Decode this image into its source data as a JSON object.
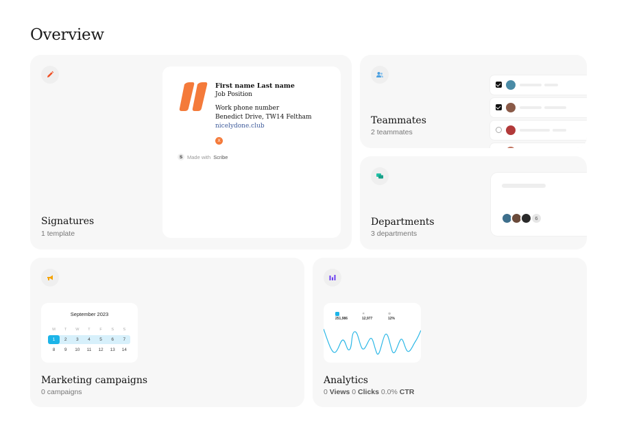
{
  "page": {
    "title": "Overview"
  },
  "signatures": {
    "title": "Signatures",
    "subtitle": "1 template",
    "preview": {
      "name": "First name Last name",
      "position": "Job Position",
      "phone": "Work phone number",
      "address": "Benedict Drive, TW14 Feltham",
      "website": "nicelydone.club",
      "social_badge": "X",
      "made_with_prefix": "Made with",
      "made_with_brand": "Scribe",
      "brand_badge": "S"
    },
    "logo_color": "#f47a3a"
  },
  "teammates": {
    "title": "Teammates",
    "subtitle": "2 teammates",
    "rows": [
      {
        "checked": true,
        "avatar_color": "#4a8ba6"
      },
      {
        "checked": true,
        "avatar_color": "#8a5a48"
      },
      {
        "checked": false,
        "avatar_color": "#b23a3a"
      }
    ]
  },
  "departments": {
    "title": "Departments",
    "subtitle": "3 departments",
    "extra_count": "6",
    "avatar_colors": [
      "#3e6f8c",
      "#6a4a3a",
      "#2a2a2a"
    ]
  },
  "marketing": {
    "title": "Marketing campaigns",
    "subtitle": "0 campaigns",
    "calendar": {
      "month": "September 2023",
      "weekdays": [
        "M",
        "T",
        "W",
        "T",
        "F",
        "S",
        "S"
      ],
      "week1": [
        "1",
        "2",
        "3",
        "4",
        "5",
        "6",
        "7"
      ],
      "week2": [
        "8",
        "9",
        "10",
        "11",
        "12",
        "13",
        "14"
      ],
      "selected": "1"
    }
  },
  "analytics": {
    "title": "Analytics",
    "views_value": "0",
    "views_label": "Views",
    "clicks_value": "0",
    "clicks_label": "Clicks",
    "ctr_value": "0.0%",
    "ctr_label": "CTR",
    "mini_stats": [
      {
        "value": "251,986"
      },
      {
        "value": "12,977"
      },
      {
        "value": "12%"
      }
    ],
    "line_color": "#2bb7e6"
  },
  "icons": {
    "signatures": "pen-icon",
    "teammates": "users-icon",
    "departments": "chat-icon",
    "marketing": "megaphone-icon",
    "analytics": "bar-chart-icon"
  }
}
